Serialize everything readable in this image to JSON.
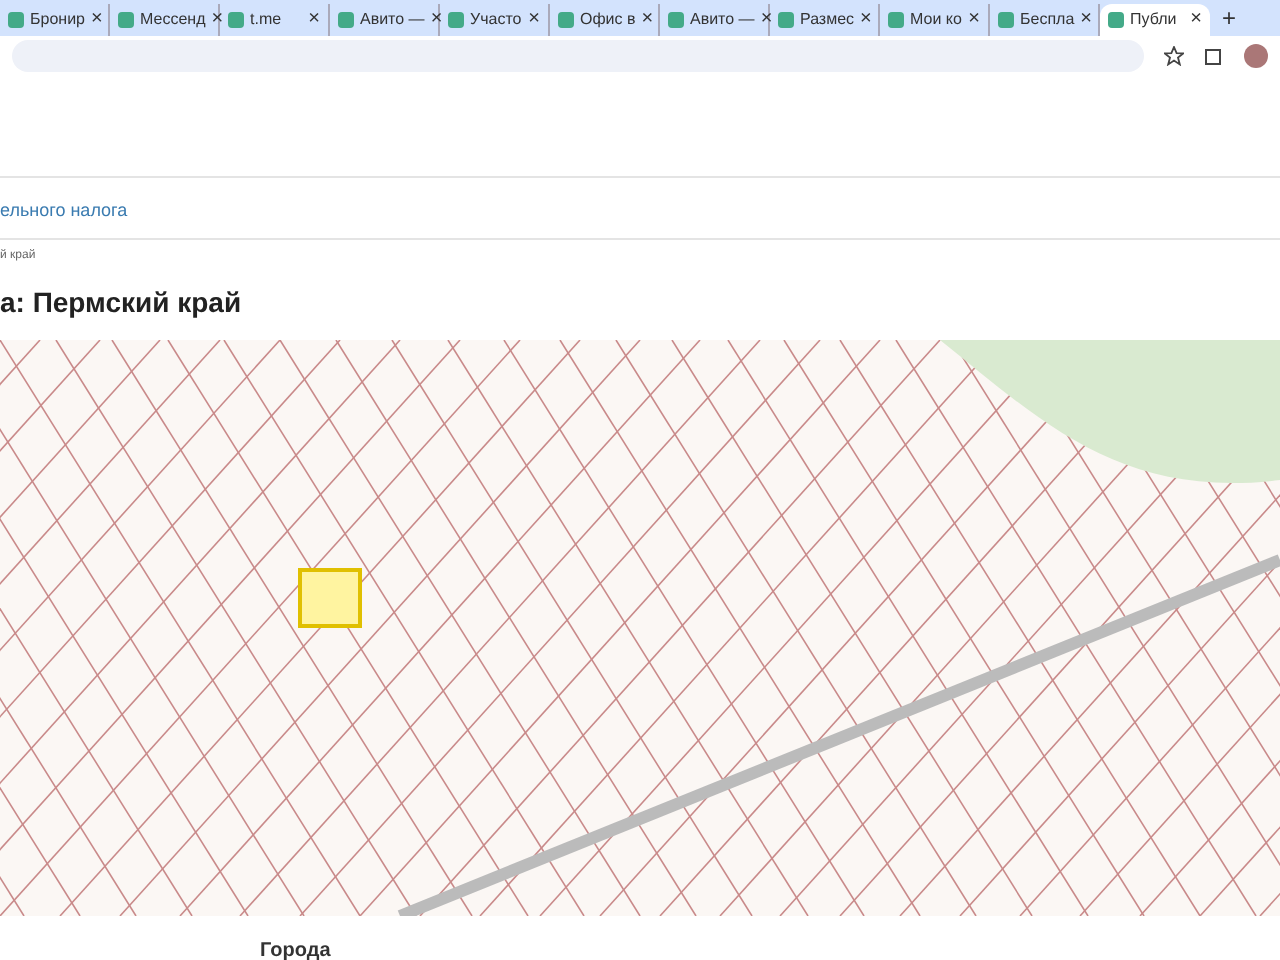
{
  "tabs": [
    {
      "label": "Бронир",
      "selected": false
    },
    {
      "label": "Мессенд",
      "selected": false
    },
    {
      "label": "t.me",
      "selected": false
    },
    {
      "label": "Авито —",
      "selected": false
    },
    {
      "label": "Участо",
      "selected": false
    },
    {
      "label": "Офис в",
      "selected": false
    },
    {
      "label": "Авито —",
      "selected": false
    },
    {
      "label": "Размес",
      "selected": false
    },
    {
      "label": "Мои ко",
      "selected": false
    },
    {
      "label": "Беспла",
      "selected": false
    },
    {
      "label": "Публи",
      "selected": true
    }
  ],
  "tab_close": "×",
  "new_tab": "+",
  "page": {
    "link": "ельного налога",
    "breadcrumb": "й край",
    "heading": "а: Пермский край",
    "section_heading": "Города"
  }
}
